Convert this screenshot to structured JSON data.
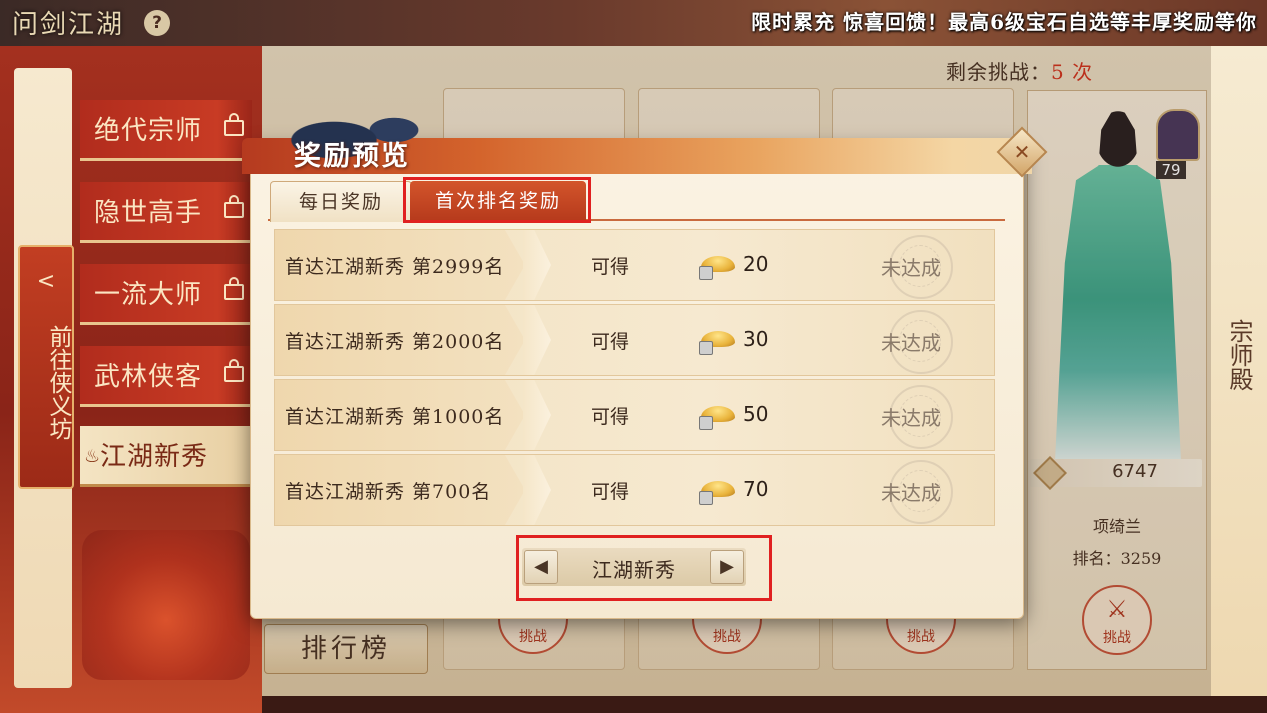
{
  "top_bar": {
    "game_title": "问剑江湖",
    "help_icon": "?",
    "banner": "限时累充 惊喜回馈！最高6级宝石自选等丰厚奖励等你"
  },
  "left_nav": {
    "goto_arrow": "<",
    "goto_label": "前往侠义坊",
    "tabs": [
      {
        "label": "绝代宗师",
        "locked": true
      },
      {
        "label": "隐世高手",
        "locked": true
      },
      {
        "label": "一流大师",
        "locked": true
      },
      {
        "label": "武林侠客",
        "locked": true
      },
      {
        "label": "江湖新秀",
        "locked": false,
        "active": true
      }
    ]
  },
  "right_nav": {
    "label": "宗师殿"
  },
  "arena": {
    "remaining_label": "剩余挑战：",
    "remaining_value": "5 次",
    "hero": {
      "level": "79",
      "power": "6747",
      "name": "项绮兰",
      "rank_label": "排名：3259"
    },
    "challenge_label": "挑战",
    "ranking_button": "排行榜"
  },
  "modal": {
    "title": "奖励预览",
    "close_icon": "✕",
    "tabs": [
      "每日奖励",
      "首次排名奖励"
    ],
    "active_tab": "首次排名奖励",
    "rows": [
      {
        "name": "首达江湖新秀 第2999名",
        "obtain": "可得",
        "amount": "20",
        "status": "未达成"
      },
      {
        "name": "首达江湖新秀 第2000名",
        "obtain": "可得",
        "amount": "30",
        "status": "未达成"
      },
      {
        "name": "首达江湖新秀 第1000名",
        "obtain": "可得",
        "amount": "50",
        "status": "未达成"
      },
      {
        "name": "首达江湖新秀 第700名",
        "obtain": "可得",
        "amount": "70",
        "status": "未达成"
      }
    ],
    "pager": {
      "prev": "◀",
      "label": "江湖新秀",
      "next": "▶"
    }
  },
  "colors": {
    "highlight_box": "#e02020",
    "accent_red": "#b63a1c",
    "gold": "#e9b33b"
  }
}
